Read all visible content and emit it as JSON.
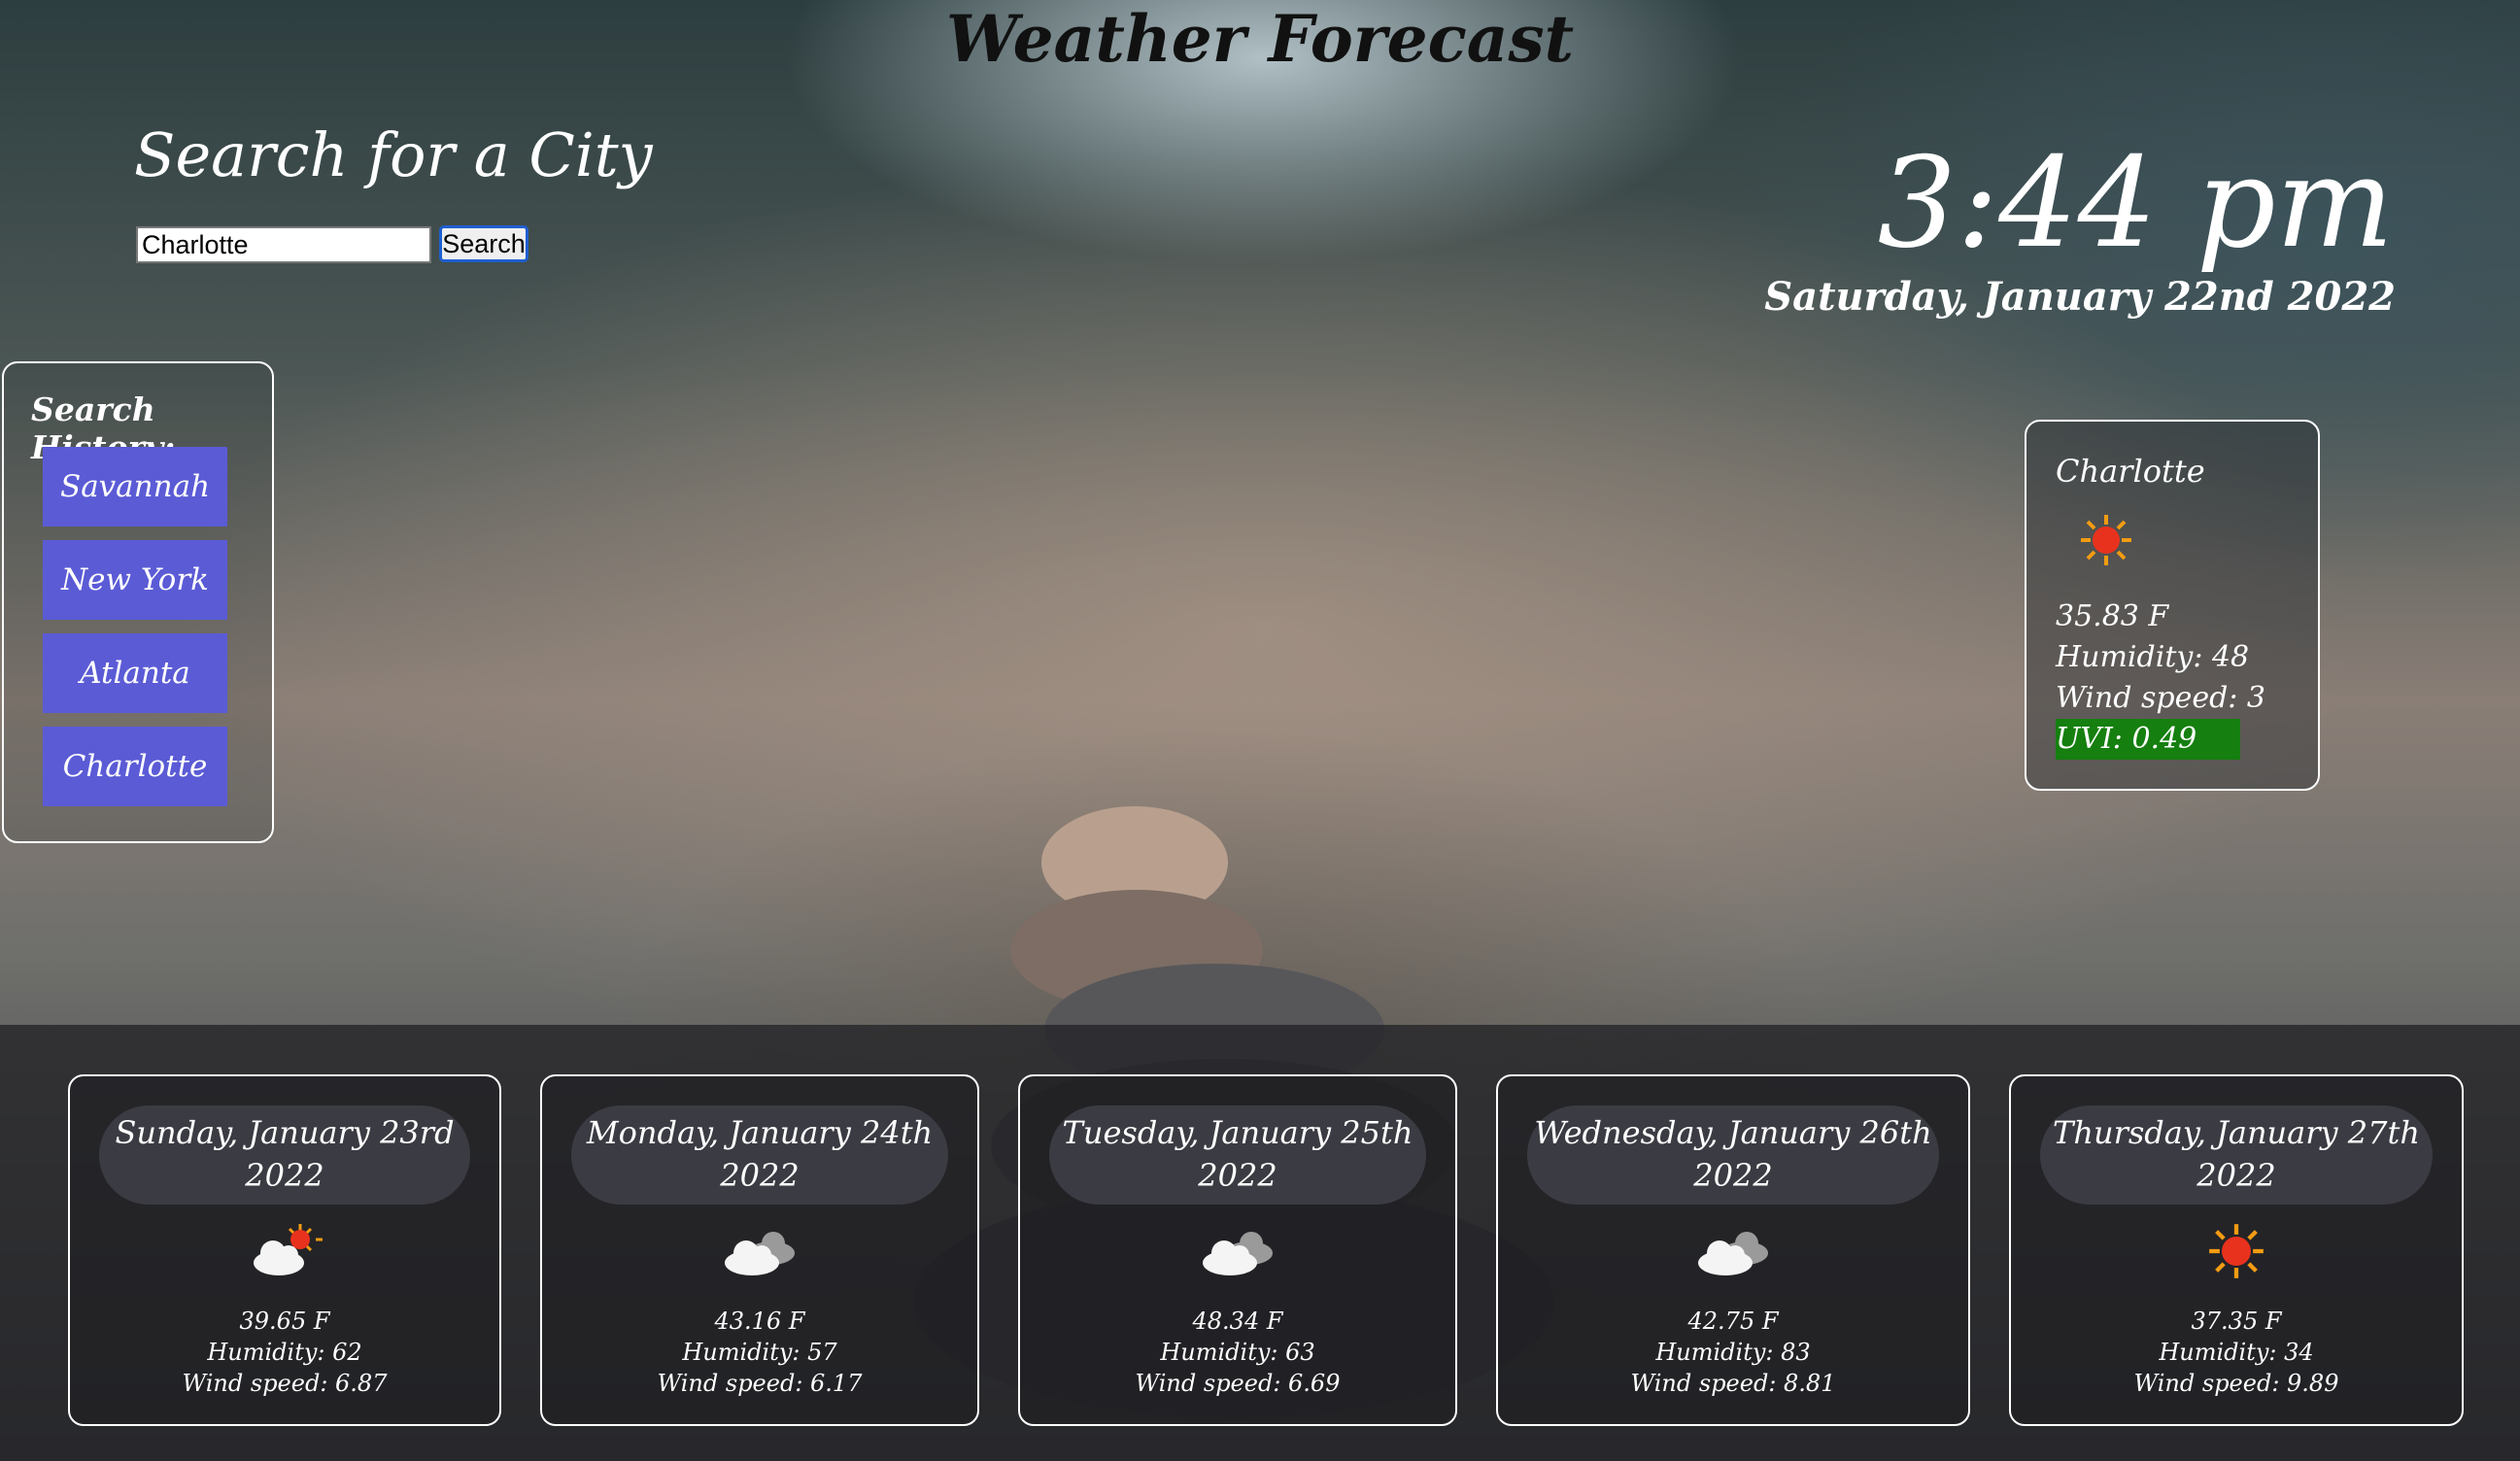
{
  "page": {
    "title": "Weather Forecast"
  },
  "search": {
    "heading": "Search for a City",
    "input_value": "Charlotte",
    "button_label": "Search"
  },
  "clock": {
    "time": "3:44 pm",
    "date": "Saturday, January 22nd 2022"
  },
  "history": {
    "title": "Search History:",
    "items": [
      "Savannah",
      "New York",
      "Atlanta",
      "Charlotte"
    ]
  },
  "current": {
    "city": "Charlotte",
    "icon": "sun-icon",
    "temp": "35.83 F",
    "humidity": "Humidity: 48",
    "wind": "Wind speed: 3",
    "uvi": "UVI: 0.49",
    "uvi_color": "#157f0f"
  },
  "forecast": [
    {
      "day": "Sunday, January 23rd",
      "year": "2022",
      "icon": "partly-sunny-icon",
      "temp": "39.65 F",
      "humidity": "Humidity: 62",
      "wind": "Wind speed: 6.87"
    },
    {
      "day": "Monday, January 24th",
      "year": "2022",
      "icon": "clouds-icon",
      "temp": "43.16 F",
      "humidity": "Humidity: 57",
      "wind": "Wind speed: 6.17"
    },
    {
      "day": "Tuesday, January 25th",
      "year": "2022",
      "icon": "clouds-icon",
      "temp": "48.34 F",
      "humidity": "Humidity: 63",
      "wind": "Wind speed: 6.69"
    },
    {
      "day": "Wednesday, January 26th",
      "year": "2022",
      "icon": "clouds-icon",
      "temp": "42.75 F",
      "humidity": "Humidity: 83",
      "wind": "Wind speed: 8.81"
    },
    {
      "day": "Thursday, January 27th",
      "year": "2022",
      "icon": "sun-icon",
      "temp": "37.35 F",
      "humidity": "Humidity: 34",
      "wind": "Wind speed: 9.89"
    }
  ]
}
